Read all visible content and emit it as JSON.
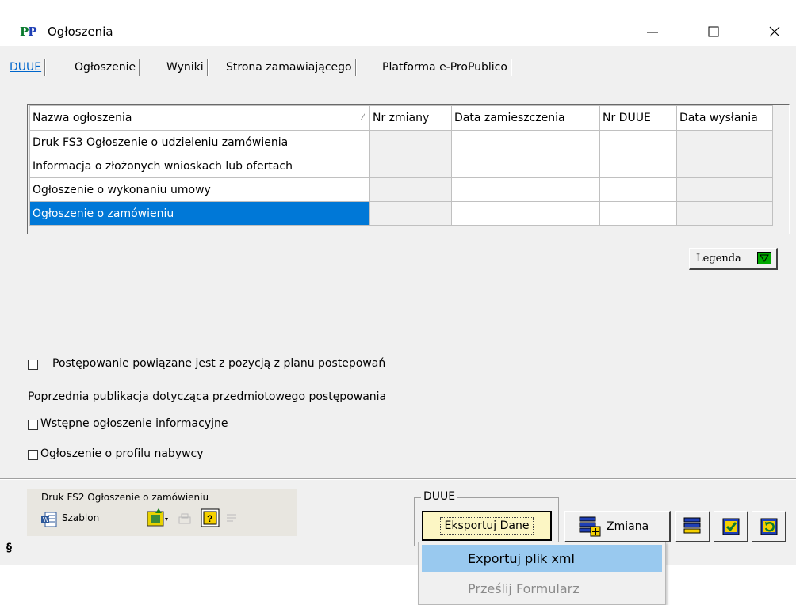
{
  "window": {
    "logo_text_1": "P",
    "logo_text_2": "P",
    "title": "Ogłoszenia"
  },
  "tabs": [
    {
      "label": "DUUE",
      "active": true
    },
    {
      "label": "Ogłoszenie"
    },
    {
      "label": "Wyniki"
    },
    {
      "label": "Strona zamawiającego"
    },
    {
      "label": "Platforma e-ProPublico"
    }
  ],
  "grid": {
    "columns": [
      "Nazwa ogłoszenia",
      "Nr zmiany",
      "Data zamieszczenia",
      "Nr DUUE",
      "Data wysłania"
    ],
    "rows": [
      {
        "name": "Druk FS3 Ogłoszenie o udzieleniu zamówienia"
      },
      {
        "name": "Informacja o złożonych wnioskach lub ofertach"
      },
      {
        "name": "Ogłoszenie o wykonaniu umowy"
      },
      {
        "name": "Ogłoszenie o zamówieniu",
        "selected": true
      }
    ]
  },
  "legenda_label": "Legenda",
  "checkbox_plan_label": "Postępowanie powiązane jest z pozycją z planu postepowań",
  "previous_pub_label": "Poprzednia publikacja dotycząca przedmiotowego postępowania",
  "checkbox_wstepne_label": "Wstępne ogłoszenie informacyjne",
  "checkbox_profil_label": "Ogłoszenie o profilu nabywcy",
  "toolbar": {
    "caption": "Druk FS2 Ogłoszenie o zamówieniu",
    "szablon_label": "Szablon",
    "section_sign": "§"
  },
  "duue_group": {
    "legend": "DUUE",
    "export_label": "Eksportuj Dane"
  },
  "zmiana_label": "Zmiana",
  "popup_menu": {
    "items": [
      "Exportuj plik xml",
      "Prześlij Formularz"
    ]
  },
  "colors": {
    "selection": "#0078d7",
    "menu_highlight": "#99c9ef",
    "export_button_bg": "#fcf6c4",
    "active_tab": "#0066cc"
  }
}
